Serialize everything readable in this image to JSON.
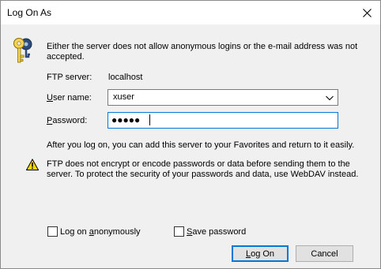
{
  "window": {
    "title": "Log On As"
  },
  "message": "Either the server does not allow anonymous logins or the e-mail address was not accepted.",
  "ftp_server": {
    "label": "FTP server:",
    "value": "localhost"
  },
  "user_name": {
    "label_prefix": "",
    "label_underlined": "U",
    "label_rest": "ser name:",
    "value": "xuser"
  },
  "password": {
    "label_underlined": "P",
    "label_rest": "assword:",
    "masked_value": "●●●●●"
  },
  "after_logon_text": "After you log on, you can add this server to your Favorites and return to it easily.",
  "warning_text": "FTP does not encrypt or encode passwords or data before sending them to the server.  To protect the security of your passwords and data, use WebDAV instead.",
  "checkboxes": {
    "anonymous": {
      "label_prefix": "Log on ",
      "label_underlined": "a",
      "label_rest": "nonymously",
      "checked": false
    },
    "save_password": {
      "label_underlined": "S",
      "label_rest": "ave password",
      "checked": false
    }
  },
  "buttons": {
    "ok_prefix": "",
    "ok_underlined": "L",
    "ok_rest": "og On",
    "cancel": "Cancel"
  },
  "colors": {
    "focus_border": "#0078d7",
    "warning_yellow": "#ffd700"
  },
  "icons": {
    "title_close": "close-icon",
    "key": "key-icon",
    "warning": "warning-icon",
    "dropdown": "chevron-down-icon"
  }
}
